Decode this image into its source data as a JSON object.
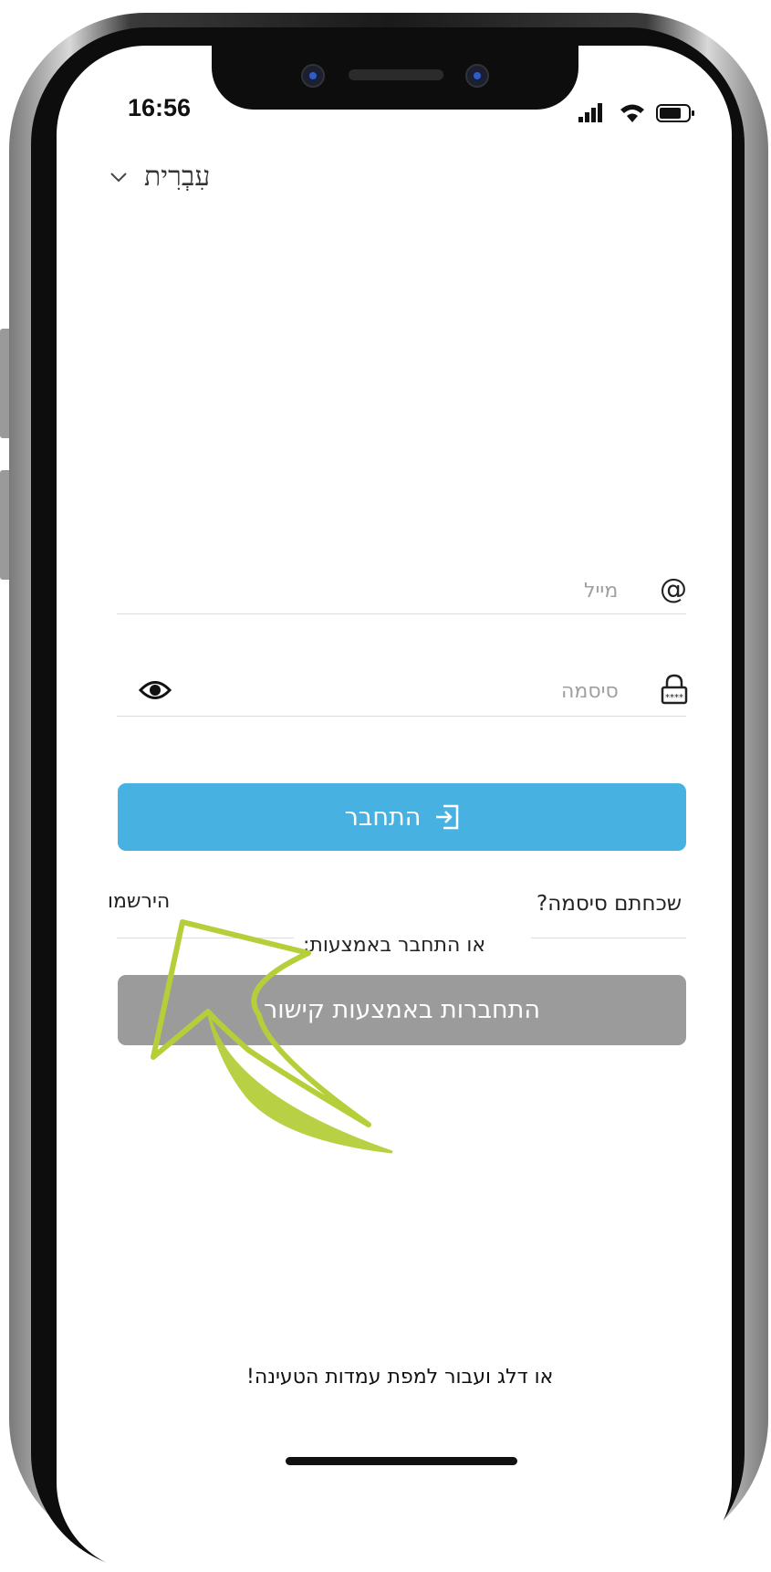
{
  "status_bar": {
    "time": "16:56"
  },
  "language": {
    "label": "עִבְרִית"
  },
  "email_field": {
    "placeholder": "מייל"
  },
  "password_field": {
    "placeholder": "סיסמה"
  },
  "login_button": {
    "label": "התחבר"
  },
  "links": {
    "forgot_password": "שכחתם סיסמה?",
    "register": "הירשמו"
  },
  "divider": {
    "text": "או התחבר באמצעות:"
  },
  "key_button": {
    "label": "התחברות באמצעות קישור"
  },
  "footer": {
    "skip_text": "או דלג ועבור למפת עמדות הטעינה!"
  },
  "colors": {
    "primary": "#47b2e1",
    "secondary_button": "#9b9b9b",
    "annotation_arrow": "#b5cf3a"
  }
}
